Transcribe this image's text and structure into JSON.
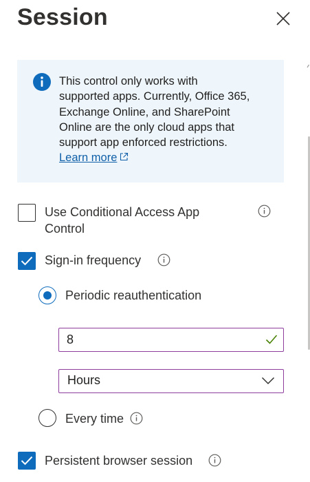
{
  "panel": {
    "title": "Session",
    "close_label": "Close"
  },
  "info": {
    "lines": [
      "This control only works with",
      "supported apps. Currently, Office 365,",
      "Exchange Online, and SharePoint",
      "Online are the only cloud apps that",
      "support app enforced restrictions."
    ],
    "link_text": "Learn more"
  },
  "options": {
    "app_control": {
      "lines": [
        "Use Conditional Access App",
        "Control"
      ],
      "checked": false
    },
    "sign_in_frequency": {
      "label": "Sign-in frequency",
      "checked": true
    },
    "periodic": {
      "label": "Periodic reauthentication",
      "selected": true
    },
    "frequency_value": "8",
    "frequency_unit": {
      "selected": "Hours"
    },
    "every_time": {
      "label": "Every time",
      "selected": false
    },
    "persistent_browser": {
      "label": "Persistent browser session",
      "checked": true
    }
  },
  "colors": {
    "accent": "#0f6cbd",
    "info_bg": "#eef6fc",
    "field_border": "#8e3d9e",
    "valid": "#498205"
  }
}
